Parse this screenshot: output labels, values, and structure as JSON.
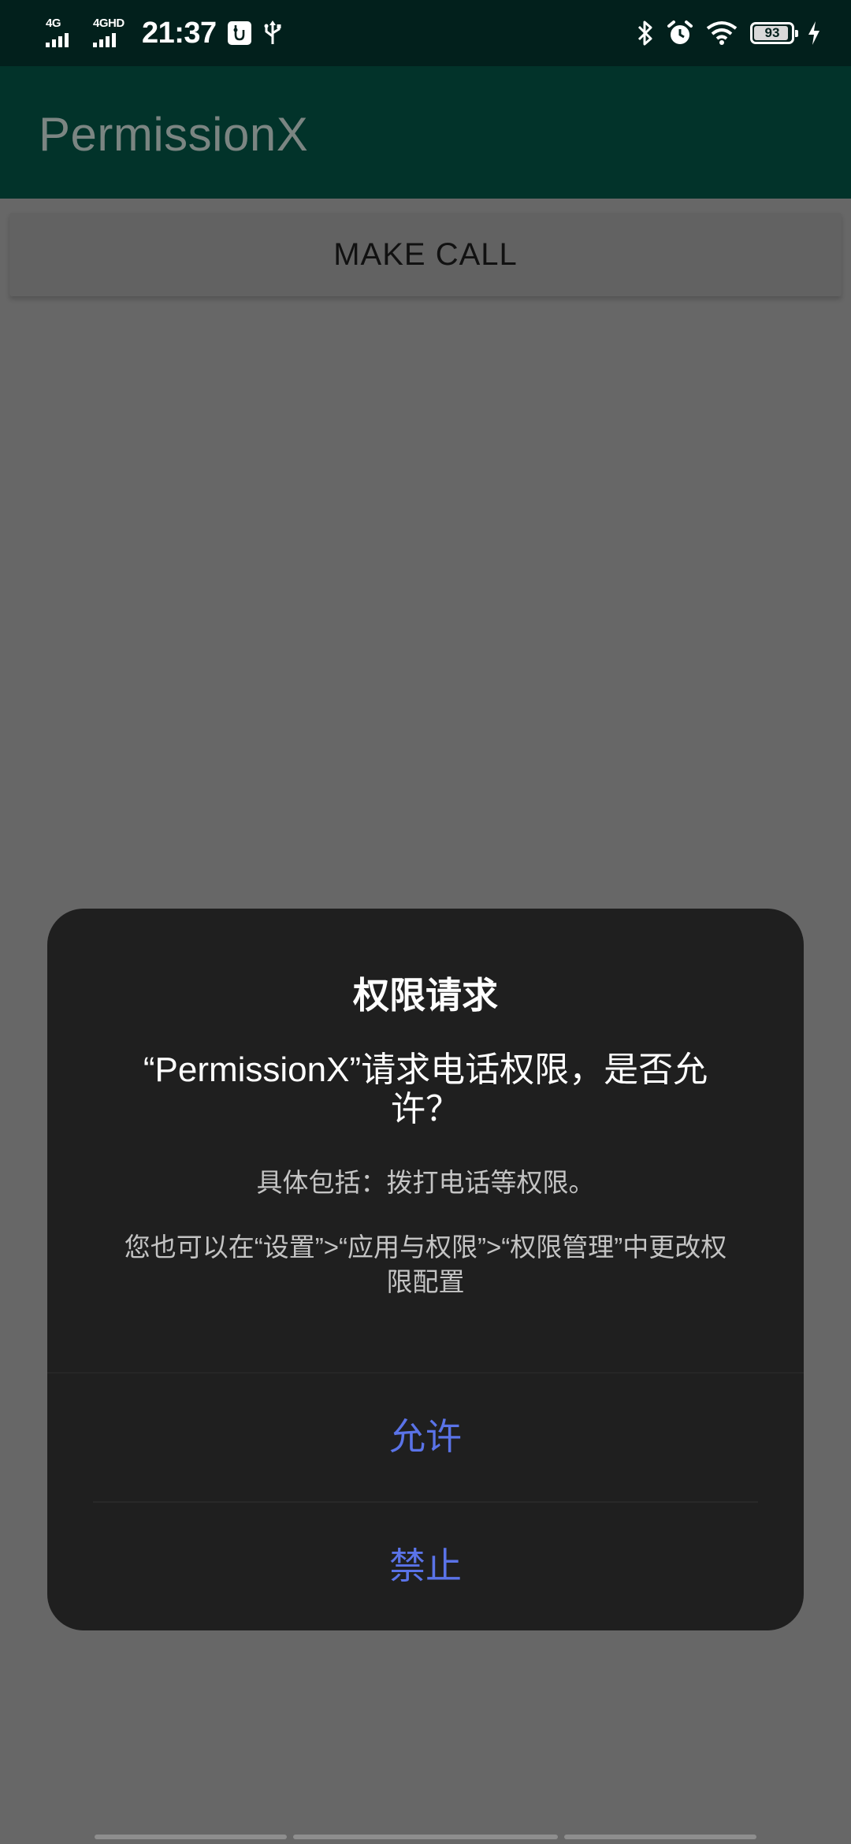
{
  "status_bar": {
    "network_1": "4G",
    "network_2": "4GHD",
    "time": "21:37",
    "battery_level": "93",
    "battery_fraction": 0.93,
    "icons": [
      "usb-debug-icon",
      "usb-icon",
      "bluetooth-icon",
      "alarm-icon",
      "wifi-icon",
      "battery-icon",
      "charging-icon"
    ]
  },
  "app_bar": {
    "title": "PermissionX"
  },
  "main": {
    "make_call_label": "MAKE CALL"
  },
  "dialog": {
    "title": "权限请求",
    "message": "“PermissionX”请求电话权限，是否允许？",
    "detail": "具体包括：拨打电话等权限。",
    "note": "您也可以在“设置”>“应用与权限”>“权限管理”中更改权限配置",
    "allow_label": "允许",
    "deny_label": "禁止",
    "accent_color": "#5a73e8"
  },
  "colors": {
    "status_bar_bg": "#02201c",
    "app_bar_bg": "#02332a",
    "scrim_bg": "#676767",
    "dialog_bg": "#1f1f1f"
  }
}
